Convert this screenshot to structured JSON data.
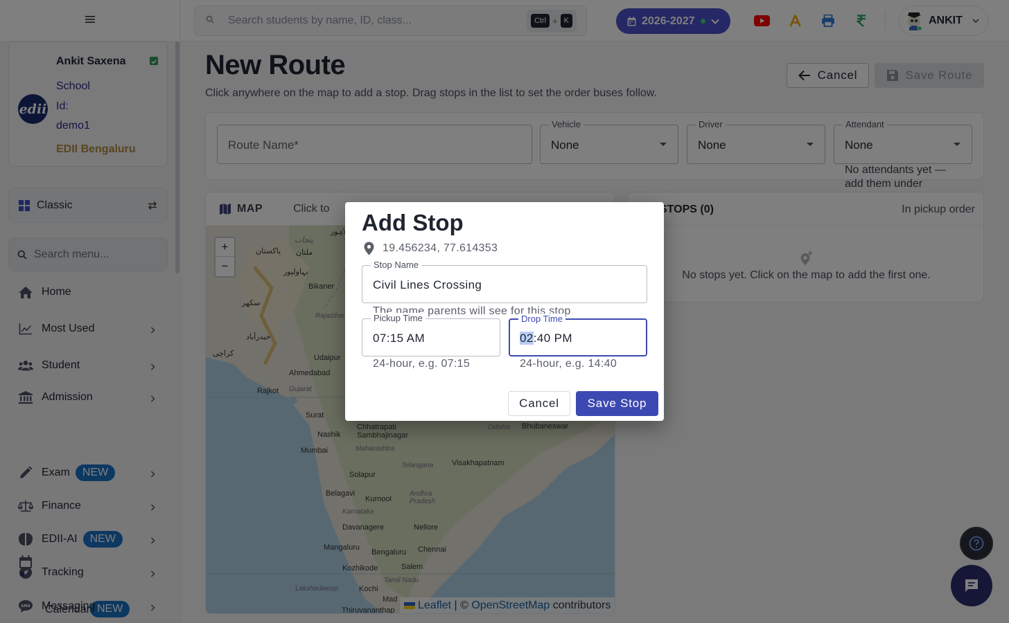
{
  "topbar": {
    "search_placeholder": "Search students by name, ID, class...",
    "shortcut": [
      "Ctrl",
      "+",
      "K"
    ],
    "academic_year": "2026-2027",
    "user_name": "ANKIT",
    "icons": [
      "youtube-icon",
      "font-icon",
      "printer-icon",
      "rupee-icon"
    ]
  },
  "sidebar": {
    "profile": {
      "name": "Ankit Saxena",
      "school_id_label": "School Id:",
      "school_id": "demo1",
      "branch": "EDII Bengaluru",
      "logo_text": "edii"
    },
    "layout_toggle": "Classic",
    "search_placeholder": "Search menu...",
    "items": [
      {
        "label": "Home",
        "icon": "home-icon"
      },
      {
        "label": "Most Used",
        "icon": "chart-line-icon"
      },
      {
        "label": "Student",
        "icon": "users-icon"
      },
      {
        "label": "Admission",
        "icon": "bank-icon"
      },
      {
        "label": "Exam",
        "icon": "pencil-icon",
        "badge": "NEW"
      },
      {
        "label": "Finance",
        "icon": "scale-icon"
      },
      {
        "label": "EDII-AI",
        "icon": "brain-icon",
        "badge": "NEW"
      },
      {
        "label": "Tracking",
        "icon": "compass-icon"
      },
      {
        "label": "Calendar",
        "icon": "calendar-icon",
        "badge": "NEW"
      },
      {
        "label": "Messaging",
        "icon": "sms-icon"
      }
    ]
  },
  "page": {
    "title": "New Route",
    "subtitle": "Click anywhere on the map to add a stop. Drag stops in the list to set the order buses follow.",
    "cancel_label": "Cancel",
    "save_label": "Save Route"
  },
  "form": {
    "route_name_placeholder": "Route Name*",
    "vehicle_label": "Vehicle",
    "vehicle_value": "None",
    "driver_label": "Driver",
    "driver_value": "None",
    "attendant_label": "Attendant",
    "attendant_value": "None",
    "attendant_help": "No attendants yet — add them under Drivers"
  },
  "map": {
    "header": "MAP",
    "hint": "Click to",
    "zoom_in": "+",
    "zoom_out": "−",
    "attribution": {
      "leaflet": "Leaflet",
      "sep": " | © ",
      "osm": "OpenStreetMap",
      "suffix": " contributors"
    },
    "places": [
      {
        "name": "لاہور"
      },
      {
        "name": "پاکستان"
      },
      {
        "name": "ملتان"
      },
      {
        "name": "پنجاب"
      },
      {
        "name": "بہاولپور"
      },
      {
        "name": "Bikaner"
      },
      {
        "name": "سکھر"
      },
      {
        "name": "Rajasthan"
      },
      {
        "name": "حیدرآباد"
      },
      {
        "name": "کراچی"
      },
      {
        "name": "Udaipur"
      },
      {
        "name": "Ahmedabad"
      },
      {
        "name": "Rajkot"
      },
      {
        "name": "Gujarat"
      },
      {
        "name": "Surat"
      },
      {
        "name": "Nashik"
      },
      {
        "name": "Mumbai"
      },
      {
        "name": "Chhatrapati Sambhajinagar"
      },
      {
        "name": "Maharashtra"
      },
      {
        "name": "Solapur"
      },
      {
        "name": "Telangana"
      },
      {
        "name": "Visakhapatnam"
      },
      {
        "name": "Bhubaneswar"
      },
      {
        "name": "Odisha"
      },
      {
        "name": "Belagavi"
      },
      {
        "name": "Kurnool"
      },
      {
        "name": "Andhra Pradesh"
      },
      {
        "name": "Karnataka"
      },
      {
        "name": "Davanagere"
      },
      {
        "name": "Nellore"
      },
      {
        "name": "Mangaluru"
      },
      {
        "name": "Bengaluru"
      },
      {
        "name": "Chennai"
      },
      {
        "name": "Kozhikode"
      },
      {
        "name": "Salem"
      },
      {
        "name": "Tamil Nadu"
      },
      {
        "name": "Lakshadweep"
      },
      {
        "name": "Kochi"
      },
      {
        "name": "Mad"
      },
      {
        "name": "Thiruvananthap"
      }
    ]
  },
  "stops": {
    "title": "STOPS (0)",
    "order_label": "In pickup order",
    "empty_text": "No stops yet. Click on the map to add the first one."
  },
  "dialog": {
    "title": "Add Stop",
    "coordinates": "19.456234, 77.614353",
    "stop_name_label": "Stop Name",
    "stop_name_value": "Civil Lines Crossing",
    "stop_name_help": "The name parents will see for this stop",
    "pickup_label": "Pickup Time",
    "pickup_value": "07:15 AM",
    "pickup_help": "24-hour, e.g. 07:15",
    "drop_label": "Drop Time",
    "drop_value_hh": "02",
    "drop_value_rest": ":40 PM",
    "drop_help": "24-hour, e.g. 14:40",
    "cancel_label": "Cancel",
    "save_label": "Save Stop"
  },
  "colors": {
    "primary": "#3d49b2",
    "year_chip": "#4a50c8",
    "badge_new": "#1870c2",
    "branch_text": "#b28b3f"
  }
}
